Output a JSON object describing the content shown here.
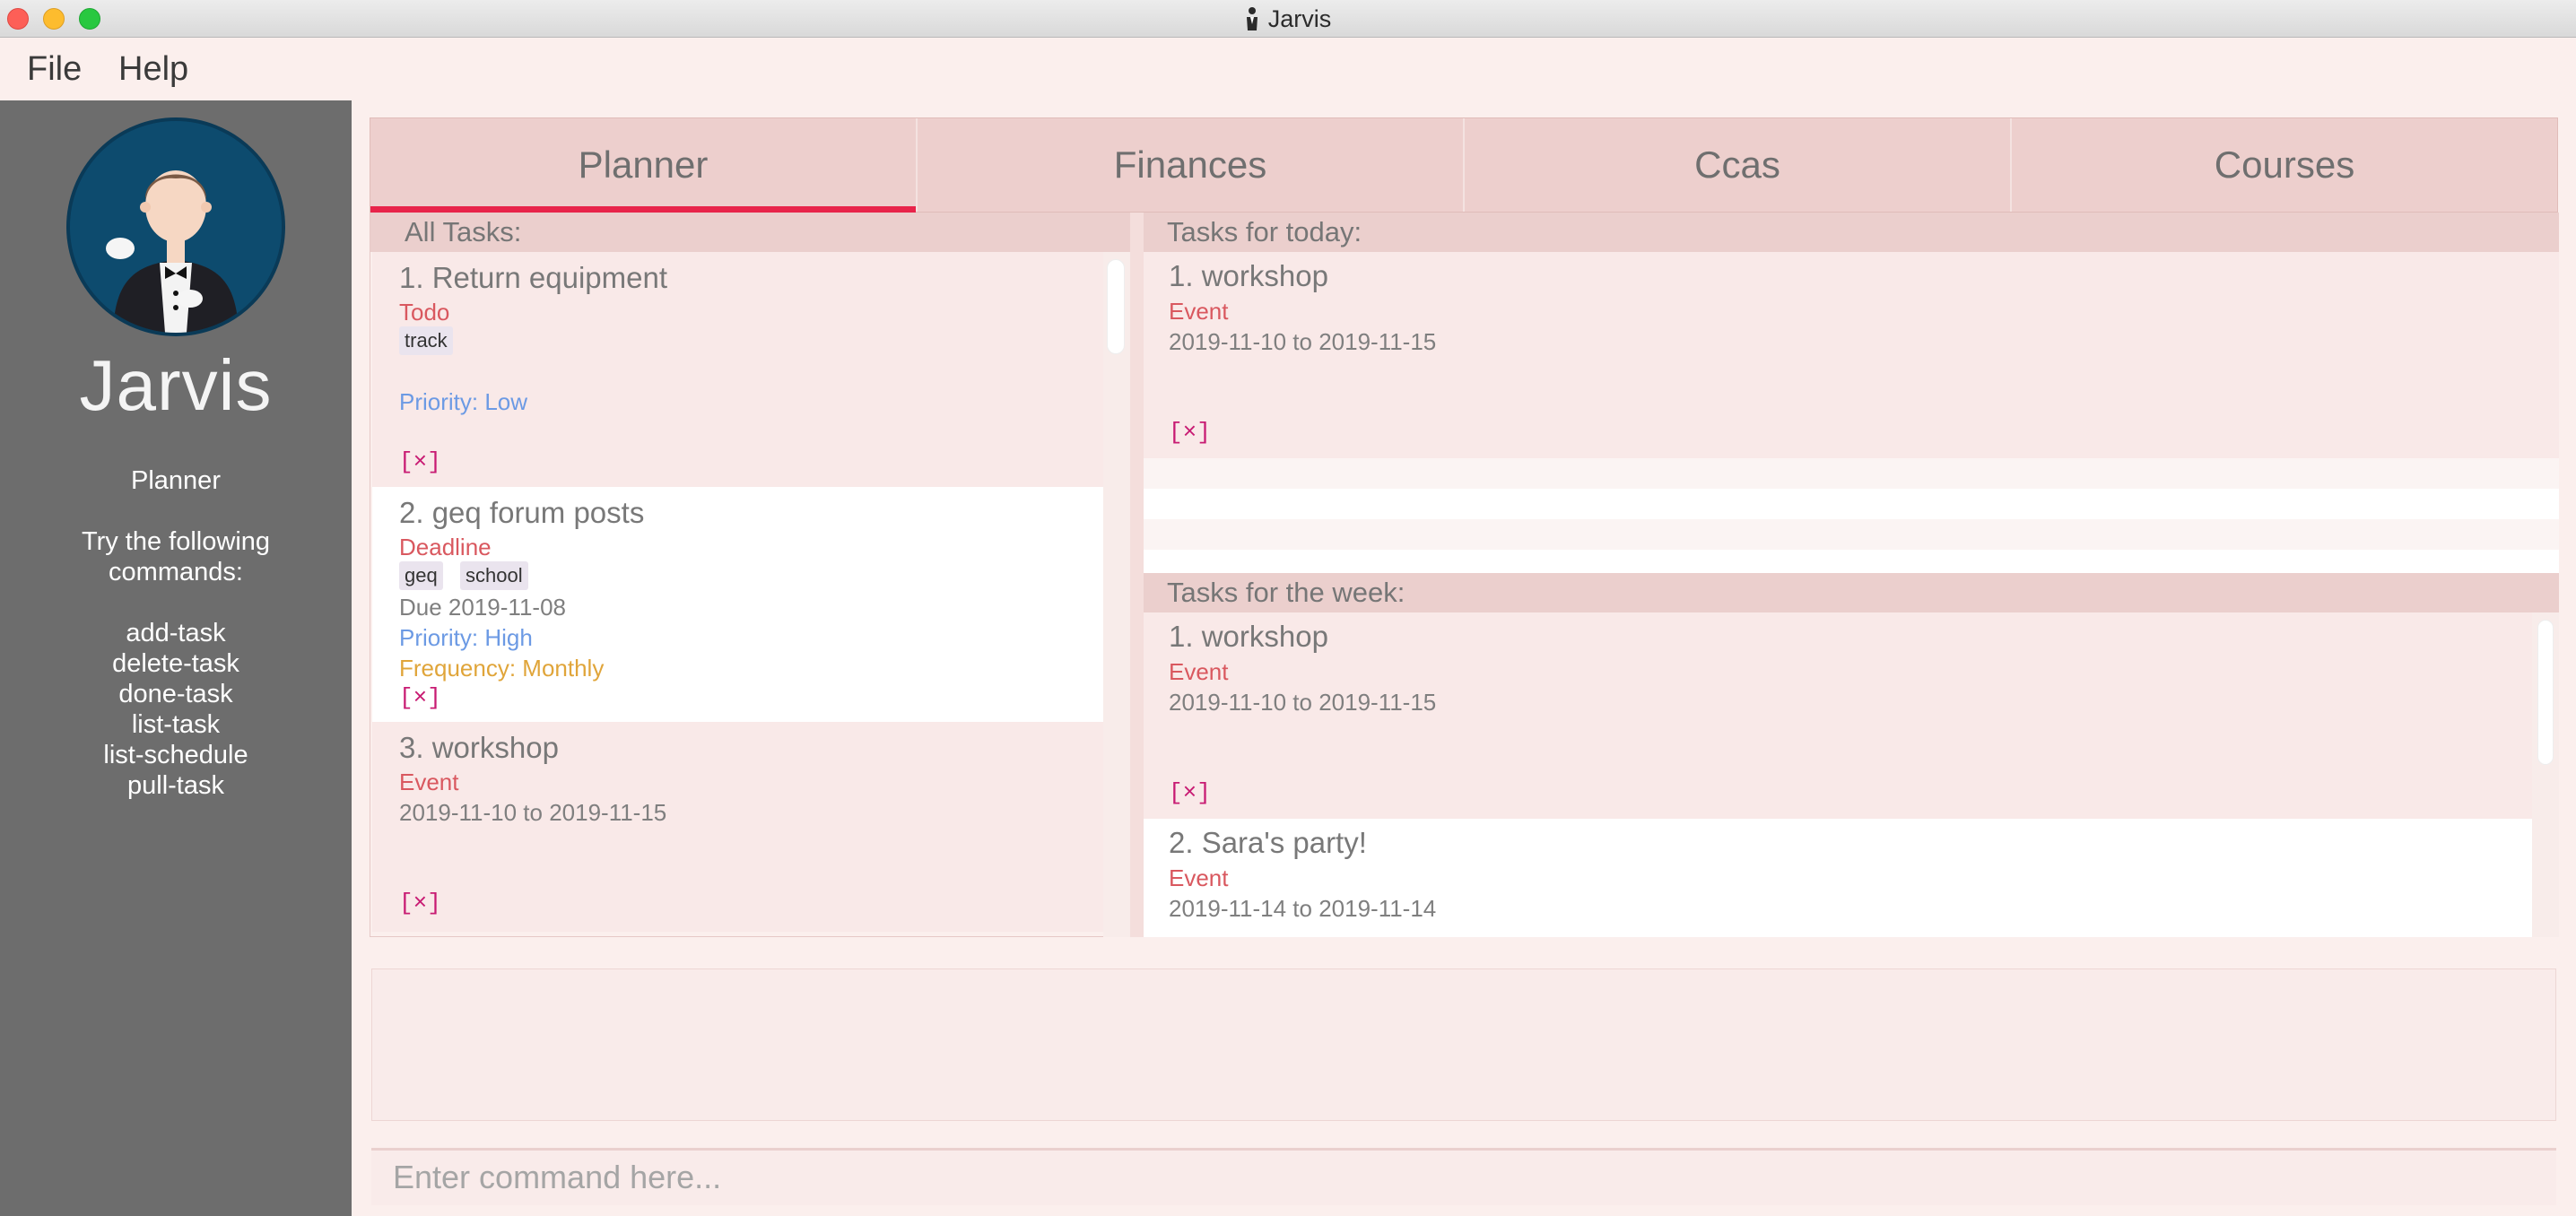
{
  "window": {
    "title": "Jarvis"
  },
  "menu": {
    "file": "File",
    "help": "Help"
  },
  "sidebar": {
    "app_name": "Jarvis",
    "section": "Planner",
    "hint_line1": "Try the following",
    "hint_line2": "commands:",
    "commands": [
      "add-task",
      "delete-task",
      "done-task",
      "list-task",
      "list-schedule",
      "pull-task"
    ]
  },
  "tabs": [
    {
      "label": "Planner",
      "active": true
    },
    {
      "label": "Finances",
      "active": false
    },
    {
      "label": "Ccas",
      "active": false
    },
    {
      "label": "Courses",
      "active": false
    }
  ],
  "all_tasks": {
    "header": "All Tasks:",
    "items": [
      {
        "title": "1. Return equipment",
        "type": "Todo",
        "tags": [
          "track"
        ],
        "priority": "Priority: Low",
        "close": "[×]"
      },
      {
        "title": "2. geq forum posts",
        "type": "Deadline",
        "tags": [
          "geq",
          "school"
        ],
        "due": "Due 2019-11-08",
        "priority": "Priority: High",
        "frequency": "Frequency: Monthly",
        "close": "[×]"
      },
      {
        "title": "3. workshop",
        "type": "Event",
        "dates": "2019-11-10 to 2019-11-15",
        "close": "[×]"
      }
    ]
  },
  "today": {
    "header": "Tasks for today:",
    "items": [
      {
        "title": "1. workshop",
        "type": "Event",
        "dates": "2019-11-10 to 2019-11-15",
        "close": "[×]"
      }
    ]
  },
  "week": {
    "header": "Tasks for the week:",
    "items": [
      {
        "title": "1. workshop",
        "type": "Event",
        "dates": "2019-11-10 to 2019-11-15",
        "close": "[×]"
      },
      {
        "title": "2. Sara's party!",
        "type": "Event",
        "dates": "2019-11-14 to 2019-11-14"
      }
    ]
  },
  "command": {
    "placeholder": "Enter command here..."
  },
  "colors": {
    "accent": "#e8244a",
    "sidebar": "#6d6d6d",
    "type": "#d9585f",
    "priority": "#6c9ae4",
    "frequency": "#e0a53a",
    "close": "#c81c73"
  }
}
